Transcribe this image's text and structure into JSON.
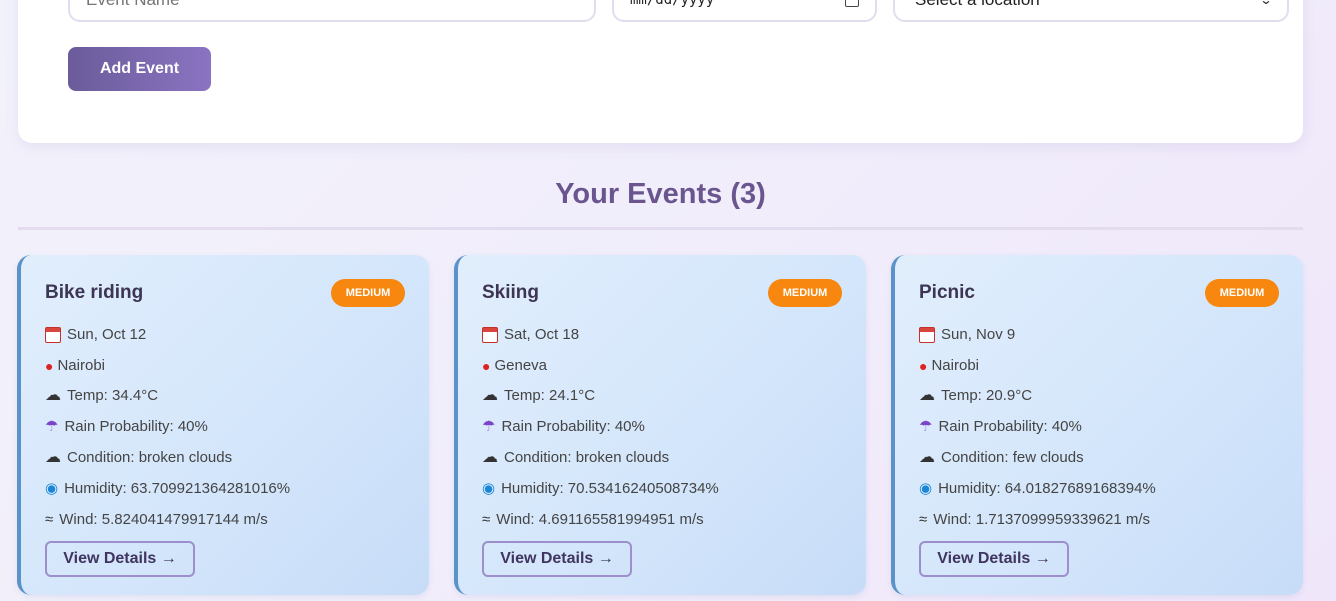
{
  "form": {
    "name_placeholder": "Event Name",
    "date_placeholder": "mm/dd/yyyy",
    "location_selected": "Select a location",
    "add_button": "Add Event"
  },
  "events_section": {
    "title": "Your Events (3)"
  },
  "events": [
    {
      "title": "Bike riding",
      "priority": "MEDIUM",
      "date": "Sun, Oct 12",
      "location": "Nairobi",
      "temp": "Temp: 34.4°C",
      "rain": "Rain Probability: 40%",
      "condition": "Condition: broken clouds",
      "humidity": "Humidity: 63.709921364281016%",
      "wind": "Wind: 5.824041479917144 m/s",
      "details_button": "View Details →"
    },
    {
      "title": "Skiing",
      "priority": "MEDIUM",
      "date": "Sat, Oct 18",
      "location": "Geneva",
      "temp": "Temp: 24.1°C",
      "rain": "Rain Probability: 40%",
      "condition": "Condition: broken clouds",
      "humidity": "Humidity: 70.53416240508734%",
      "wind": "Wind: 4.691165581994951 m/s",
      "details_button": "View Details →"
    },
    {
      "title": "Picnic",
      "priority": "MEDIUM",
      "date": "Sun, Nov 9",
      "location": "Nairobi",
      "temp": "Temp: 20.9°C",
      "rain": "Rain Probability: 40%",
      "condition": "Condition: few clouds",
      "humidity": "Humidity: 64.01827689168394%",
      "wind": "Wind: 1.7137099959339621 m/s",
      "details_button": "View Details →"
    }
  ],
  "colors": {
    "accent": "#6a558f",
    "badge_medium": "#f7870e",
    "card_border": "#5b93c8"
  },
  "icons": [
    "calendar-icon",
    "pin-icon",
    "cloud-icon",
    "umbrella-icon",
    "droplet-icon",
    "wind-icon",
    "chevron-down-icon"
  ]
}
